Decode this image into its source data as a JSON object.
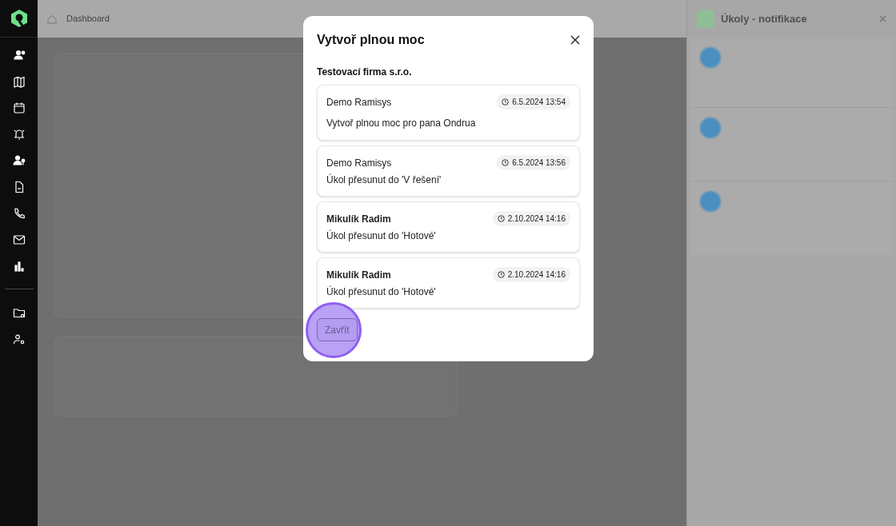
{
  "breadcrumb": "Dashboard",
  "notifications_panel": {
    "title": "Úkoly - notifikace"
  },
  "modal": {
    "title": "Vytvoř plnou moc",
    "company": "Testovací firma s.r.o.",
    "entries": [
      {
        "author": "Demo Ramisys",
        "author_bold": false,
        "time": "6.5.2024 13:54",
        "text": "Vytvoř plnou moc pro pana Ondrua"
      },
      {
        "author": "Demo Ramisys",
        "author_bold": false,
        "time": "6.5.2024 13:56",
        "text": "Úkol přesunut do 'V řešení'"
      },
      {
        "author": "Mikulík Radim",
        "author_bold": true,
        "time": "2.10.2024 14:16",
        "text": "Úkol přesunut do 'Hotové'"
      },
      {
        "author": "Mikulík Radim",
        "author_bold": true,
        "time": "2.10.2024 14:16",
        "text": "Úkol přesunut do 'Hotové'"
      }
    ],
    "close_button": {
      "label": "Zavřít",
      "highlighted": true
    }
  }
}
